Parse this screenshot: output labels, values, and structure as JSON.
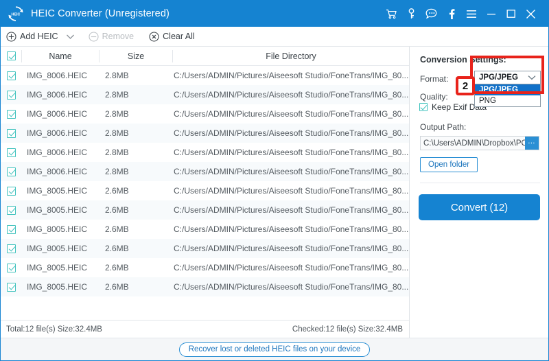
{
  "window": {
    "title": "HEIC Converter (Unregistered)",
    "logo_text": "HEIC",
    "accent_color": "#1583d1",
    "controls": [
      {
        "name": "cart-icon",
        "label": "Cart"
      },
      {
        "name": "key-icon",
        "label": "Register"
      },
      {
        "name": "chat-icon",
        "label": "Feedback"
      },
      {
        "name": "facebook-icon",
        "label": "f"
      },
      {
        "name": "menu-icon",
        "label": "Menu"
      },
      {
        "name": "minimize-icon",
        "label": "Minimize"
      },
      {
        "name": "maximize-icon",
        "label": "Maximize"
      },
      {
        "name": "close-icon",
        "label": "Close"
      }
    ]
  },
  "toolbar": {
    "add_label": "Add HEIC",
    "remove_label": "Remove",
    "clear_label": "Clear All"
  },
  "filelist": {
    "columns": [
      "Name",
      "Size",
      "File Directory"
    ],
    "header_checkbox_checked": true,
    "rows": [
      {
        "checked": true,
        "name": "IMG_8006.HEIC",
        "size": "2.8MB",
        "dir": "C:/Users/ADMIN/Pictures/Aiseesoft Studio/FoneTrans/IMG_80..."
      },
      {
        "checked": true,
        "name": "IMG_8006.HEIC",
        "size": "2.8MB",
        "dir": "C:/Users/ADMIN/Pictures/Aiseesoft Studio/FoneTrans/IMG_80..."
      },
      {
        "checked": true,
        "name": "IMG_8006.HEIC",
        "size": "2.8MB",
        "dir": "C:/Users/ADMIN/Pictures/Aiseesoft Studio/FoneTrans/IMG_80..."
      },
      {
        "checked": true,
        "name": "IMG_8006.HEIC",
        "size": "2.8MB",
        "dir": "C:/Users/ADMIN/Pictures/Aiseesoft Studio/FoneTrans/IMG_80..."
      },
      {
        "checked": true,
        "name": "IMG_8006.HEIC",
        "size": "2.8MB",
        "dir": "C:/Users/ADMIN/Pictures/Aiseesoft Studio/FoneTrans/IMG_80..."
      },
      {
        "checked": true,
        "name": "IMG_8006.HEIC",
        "size": "2.8MB",
        "dir": "C:/Users/ADMIN/Pictures/Aiseesoft Studio/FoneTrans/IMG_80..."
      },
      {
        "checked": true,
        "name": "IMG_8005.HEIC",
        "size": "2.6MB",
        "dir": "C:/Users/ADMIN/Pictures/Aiseesoft Studio/FoneTrans/IMG_80..."
      },
      {
        "checked": true,
        "name": "IMG_8005.HEIC",
        "size": "2.6MB",
        "dir": "C:/Users/ADMIN/Pictures/Aiseesoft Studio/FoneTrans/IMG_80..."
      },
      {
        "checked": true,
        "name": "IMG_8005.HEIC",
        "size": "2.6MB",
        "dir": "C:/Users/ADMIN/Pictures/Aiseesoft Studio/FoneTrans/IMG_80..."
      },
      {
        "checked": true,
        "name": "IMG_8005.HEIC",
        "size": "2.6MB",
        "dir": "C:/Users/ADMIN/Pictures/Aiseesoft Studio/FoneTrans/IMG_80..."
      },
      {
        "checked": true,
        "name": "IMG_8005.HEIC",
        "size": "2.6MB",
        "dir": "C:/Users/ADMIN/Pictures/Aiseesoft Studio/FoneTrans/IMG_80..."
      },
      {
        "checked": true,
        "name": "IMG_8005.HEIC",
        "size": "2.6MB",
        "dir": "C:/Users/ADMIN/Pictures/Aiseesoft Studio/FoneTrans/IMG_80..."
      }
    ]
  },
  "status": {
    "total": "Total:12 file(s) Size:32.4MB",
    "checked": "Checked:12 file(s) Size:32.4MB"
  },
  "bottom": {
    "recover_label": "Recover lost or deleted HEIC files on your device"
  },
  "settings": {
    "title": "Conversion Settings:",
    "format_label": "Format:",
    "format_value": "JPG/JPEG",
    "format_options": [
      "JPG/JPEG",
      "PNG"
    ],
    "format_selected_index": 0,
    "quality_label": "Quality:",
    "exif_label": "Keep Exif Data",
    "exif_checked": true,
    "output_label": "Output Path:",
    "output_value": "C:\\Users\\ADMIN\\Dropbox\\PC\\",
    "browse_label": "…",
    "open_folder_label": "Open folder",
    "convert_label": "Convert (12)"
  },
  "annotations": {
    "step_badge": "2",
    "highlight_color": "#e8231b"
  }
}
